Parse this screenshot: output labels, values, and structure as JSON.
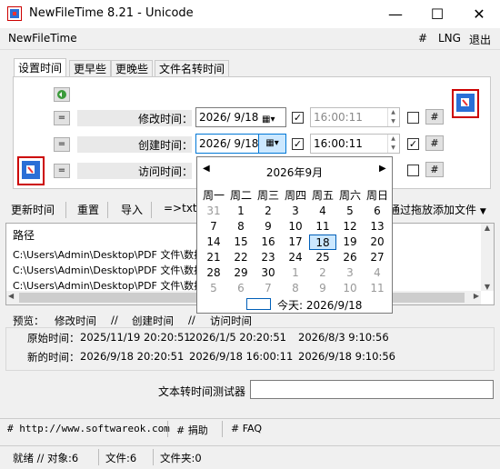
{
  "window": {
    "title": "NewFileTime 8.21 - Unicode",
    "minimize": "—",
    "maximize": "☐",
    "close": "✕"
  },
  "menu": {
    "app_name": "NewFileTime",
    "hash": "#",
    "lng": "LNG",
    "exit": "退出"
  },
  "tabs": [
    "设置时间",
    "更早些",
    "更晚些",
    "文件名转时间"
  ],
  "rows": [
    {
      "label": "修改时间：",
      "date": "2026/ 9/18",
      "time": "16:00:11",
      "btn": "=",
      "date_checked": true,
      "time_checked": false
    },
    {
      "label": "创建时间：",
      "date": "2026/ 9/18",
      "time": "16:00:11",
      "btn": "=",
      "date_checked": true,
      "time_checked": true
    },
    {
      "label": "访问时间：",
      "date": "",
      "time": "",
      "btn": "=",
      "date_checked": false,
      "time_checked": false
    }
  ],
  "hash_btn": "#",
  "toolbar": {
    "update": "更新时间",
    "reset": "重置",
    "import": "导入",
    "txt": "=>txt<",
    "drag_hint": "通过拖放添加文件"
  },
  "list": {
    "header": "路径",
    "rows": [
      "C:\\Users\\Admin\\Desktop\\PDF 文件\\数据",
      "C:\\Users\\Admin\\Desktop\\PDF 文件\\数据",
      "C:\\Users\\Admin\\Desktop\\PDF 文件\\数据"
    ]
  },
  "preview": {
    "label": "预览：",
    "h_modify": "修改时间",
    "sep1": "//",
    "h_create": "创建时间",
    "sep2": "//",
    "h_access": "访问时间",
    "original_label": "原始时间：",
    "original_modify": "2025/11/19 20:20:51",
    "original_create": "2026/1/5 20:20:51",
    "original_access": "2026/8/3 9:10:56",
    "new_label": "新的时间：",
    "new_modify": "2026/9/18 20:20:51",
    "new_create": "2026/9/18 16:00:11",
    "new_access": "2026/9/18 9:10:56"
  },
  "converter": {
    "label": "文本转时间测试器",
    "value": ""
  },
  "links": {
    "website": "# http://www.softwareok.com",
    "donate": "# 捐助",
    "faq": "# FAQ"
  },
  "status": {
    "ready": "就绪 // 对象:6",
    "files": "文件:6",
    "folders": "文件夹:0"
  },
  "calendar": {
    "title": "2026年9月",
    "prev": "◀",
    "next": "▶",
    "dow": [
      "周一",
      "周二",
      "周三",
      "周四",
      "周五",
      "周六",
      "周日"
    ],
    "weeks": [
      [
        "31",
        "1",
        "2",
        "3",
        "4",
        "5",
        "6"
      ],
      [
        "7",
        "8",
        "9",
        "10",
        "11",
        "12",
        "13"
      ],
      [
        "14",
        "15",
        "16",
        "17",
        "18",
        "19",
        "20"
      ],
      [
        "21",
        "22",
        "23",
        "24",
        "25",
        "26",
        "27"
      ],
      [
        "28",
        "29",
        "30",
        "1",
        "2",
        "3",
        "4"
      ],
      [
        "5",
        "6",
        "7",
        "8",
        "9",
        "10",
        "11"
      ]
    ],
    "selected": "18",
    "today_label": "今天: 2026/9/18"
  },
  "colors": {
    "accent": "#0078d7",
    "selected_bg": "#cce8ff"
  }
}
